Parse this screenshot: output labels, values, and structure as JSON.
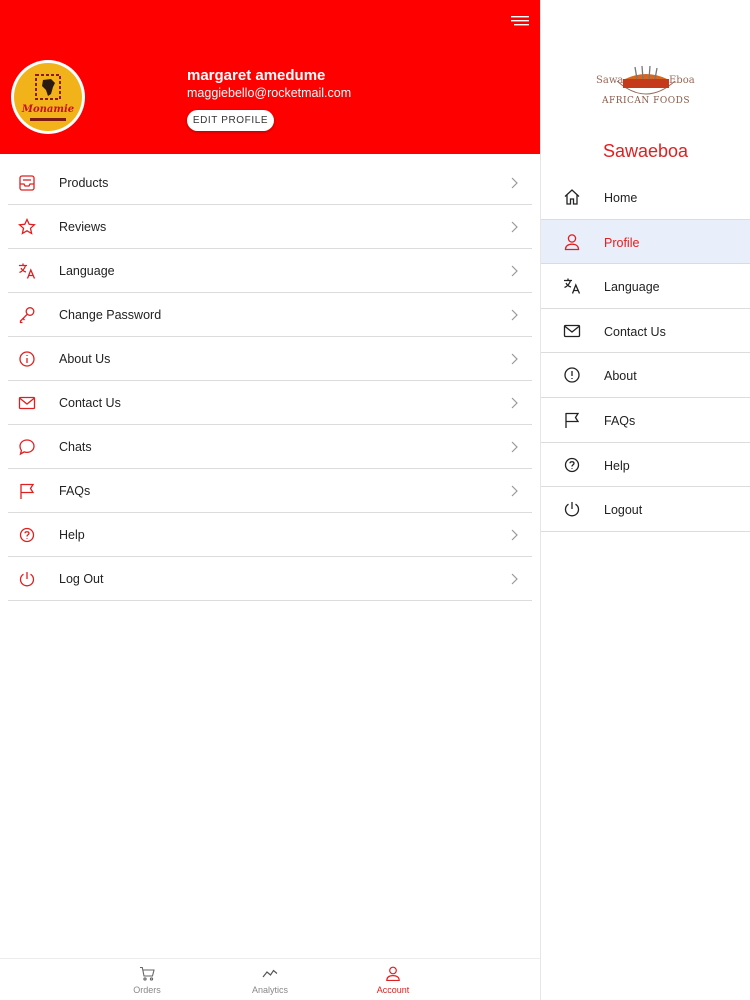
{
  "colors": {
    "accent": "#ff0000",
    "active_text": "#e02020",
    "active_bg": "#e8eefa"
  },
  "header": {
    "name": "margaret amedume",
    "email": "maggiebello@rocketmail.com",
    "edit_profile": "EDIT PROFILE",
    "avatar_logo_text": "Monamie"
  },
  "menu": [
    {
      "label": "Products",
      "icon": "inbox-icon"
    },
    {
      "label": "Reviews",
      "icon": "star-icon"
    },
    {
      "label": "Language",
      "icon": "translate-icon"
    },
    {
      "label": "Change Password",
      "icon": "key-icon"
    },
    {
      "label": "About Us",
      "icon": "info-icon"
    },
    {
      "label": "Contact Us",
      "icon": "mail-icon"
    },
    {
      "label": "Chats",
      "icon": "chat-icon"
    },
    {
      "label": "FAQs",
      "icon": "flag-icon"
    },
    {
      "label": "Help",
      "icon": "help-icon"
    },
    {
      "label": "Log Out",
      "icon": "power-icon"
    }
  ],
  "tabs": [
    {
      "label": "Orders",
      "icon": "cart-icon"
    },
    {
      "label": "Analytics",
      "icon": "analytics-icon"
    },
    {
      "label": "Account",
      "icon": "person-icon",
      "active": true
    }
  ],
  "drawer": {
    "logo_text": {
      "left": "Sawa",
      "right": "Eboa",
      "bottom": "AFRICAN FOODS"
    },
    "brand": "Sawaeboa",
    "items": [
      {
        "label": "Home",
        "icon": "home-icon"
      },
      {
        "label": "Profile",
        "icon": "person-icon",
        "active": true
      },
      {
        "label": "Language",
        "icon": "translate-icon"
      },
      {
        "label": "Contact Us",
        "icon": "mail-icon"
      },
      {
        "label": "About",
        "icon": "info-icon"
      },
      {
        "label": "FAQs",
        "icon": "flag-icon"
      },
      {
        "label": "Help",
        "icon": "help-icon"
      },
      {
        "label": "Logout",
        "icon": "power-icon"
      }
    ]
  }
}
